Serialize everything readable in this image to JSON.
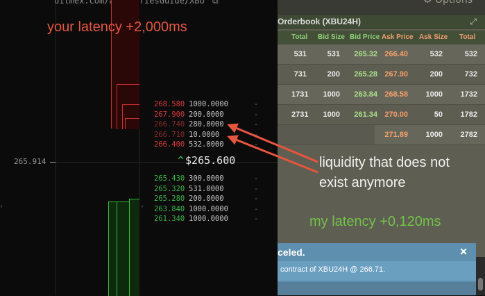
{
  "chart": {
    "url": "bitmex.com/app/seriesGuide/XBU",
    "price_axis_label": "265.914",
    "asks": [
      {
        "price": "268.580",
        "size": "1000.0000",
        "delta": "-"
      },
      {
        "price": "267.900",
        "size": "200.0000",
        "delta": "-"
      },
      {
        "price": "266.740",
        "size": "280.0000",
        "delta": "-"
      },
      {
        "price": "266.710",
        "size": "10.0000",
        "delta": "-"
      },
      {
        "price": "266.400",
        "size": "532.0000",
        "delta": "-"
      }
    ],
    "last_price": "$265.600",
    "bids": [
      {
        "price": "265.430",
        "size": "300.0000",
        "delta": "-"
      },
      {
        "price": "265.320",
        "size": "531.0000",
        "delta": "-"
      },
      {
        "price": "265.280",
        "size": "200.0000",
        "delta": "-"
      },
      {
        "price": "263.840",
        "size": "1000.0000",
        "delta": "-"
      },
      {
        "price": "261.340",
        "size": "1000.0000",
        "delta": "-"
      }
    ]
  },
  "orderbook": {
    "title": "Orderbook (XBU24H)",
    "options_label": "Options",
    "columns": [
      "Total",
      "Bid Size",
      "Bid Price",
      "Ask Price",
      "Ask Size",
      "Total"
    ],
    "rows": [
      [
        "531",
        "531",
        "265.32",
        "266.40",
        "532",
        "532"
      ],
      [
        "731",
        "200",
        "265.28",
        "267.90",
        "200",
        "732"
      ],
      [
        "1731",
        "1000",
        "263.84",
        "268.58",
        "1000",
        "1732"
      ],
      [
        "2731",
        "1000",
        "261.34",
        "270.00",
        "50",
        "1782"
      ],
      [
        "",
        "",
        "",
        "271.89",
        "1000",
        "2782"
      ]
    ]
  },
  "annotations": {
    "your_latency": "your latency +2,000ms",
    "my_latency": "my latency +0,120ms",
    "liquidity_line1": "liquidity that does not",
    "liquidity_line2": "exist anymore"
  },
  "toast": {
    "title": "celed.",
    "message": "contract of XBU24H @ 266.71."
  },
  "colors": {
    "ask": "#d43a3a",
    "bid": "#38b84a",
    "annotation_red": "#e8553e",
    "annotation_green": "#73c24a",
    "toast": "#5f8fae"
  }
}
